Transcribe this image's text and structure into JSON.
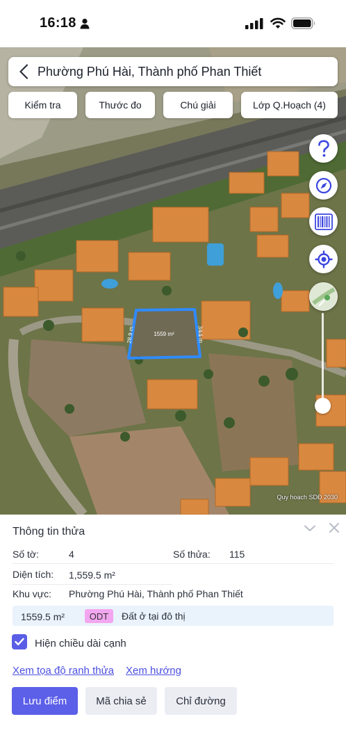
{
  "status_bar": {
    "time": "16:18"
  },
  "header": {
    "title": "Phường Phú Hài, Thành phố Phan Thiết"
  },
  "toolbar": {
    "chips": [
      "Kiểm tra",
      "Thước đo",
      "Chú giải",
      "Lớp Q.Hoạch (4)"
    ]
  },
  "map": {
    "parcel_area_label": "1559 m²",
    "edge_left_label": "28.9 m",
    "edge_right_label": "34.1 m",
    "credit": "Quy hoạch SDĐ 2030",
    "parcel_outline_color": "#2f8bff",
    "fab_icons": [
      "help-icon",
      "compass-icon",
      "barcode-icon",
      "my-location-icon",
      "layer-thumbnail-icon"
    ],
    "opacity_slider_value": 0.1
  },
  "panel": {
    "title": "Thông tin thửa",
    "so_to_label": "Số tờ:",
    "so_to_value": "4",
    "so_thua_label": "Số thửa:",
    "so_thua_value": "115",
    "dien_tich_label": "Diện tích:",
    "dien_tich_value": "1,559.5 m²",
    "khu_vuc_label": "Khu vực:",
    "khu_vuc_value": "Phường Phú Hài, Thành phố Phan Thiết",
    "zone_area": "1559.5 m²",
    "zone_code": "ODT",
    "zone_name": "Đất ở tại đô thị",
    "zone_code_color": "#f3a6f0",
    "checkbox_label": "Hiện chiều dài cạnh",
    "checkbox_checked": true,
    "link_coords": "Xem tọa độ ranh thửa",
    "link_direction": "Xem hướng",
    "btn_save": "Lưu điểm",
    "btn_share": "Mã chia sẻ",
    "btn_directions": "Chỉ đường",
    "accent_color": "#5c5fe8"
  }
}
